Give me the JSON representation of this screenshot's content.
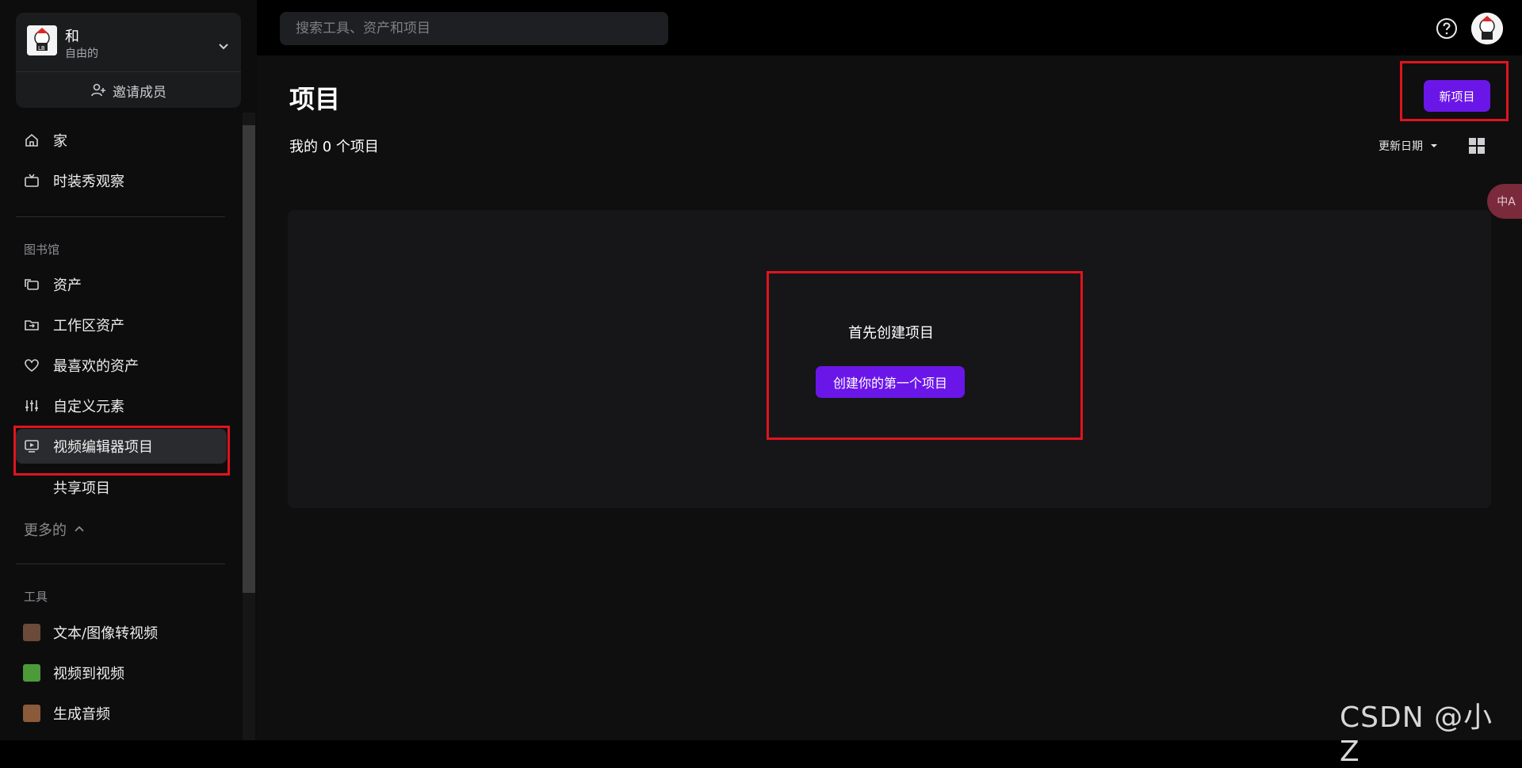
{
  "workspace": {
    "name": "和",
    "plan": "自由的",
    "invite_label": "邀请成员"
  },
  "search": {
    "placeholder": "搜索工具、资产和项目"
  },
  "nav_top": [
    {
      "label": "家",
      "icon": "home-icon"
    },
    {
      "label": "时装秀观察",
      "icon": "tv-icon"
    }
  ],
  "library": {
    "title": "图书馆",
    "items": [
      {
        "label": "资产",
        "icon": "folder-stack-icon"
      },
      {
        "label": "工作区资产",
        "icon": "folder-share-icon"
      },
      {
        "label": "最喜欢的资产",
        "icon": "heart-icon"
      },
      {
        "label": "自定义元素",
        "icon": "sliders-icon"
      },
      {
        "label": "视频编辑器项目",
        "icon": "monitor-play-icon",
        "active": true
      },
      {
        "label": "共享项目"
      }
    ],
    "more_label": "更多的"
  },
  "tools": {
    "title": "工具",
    "items": [
      {
        "label": "文本/图像转视频",
        "icon": "text-to-video-thumbnail",
        "color": "#6b4a3a"
      },
      {
        "label": "视频到视频",
        "icon": "video-to-video-thumbnail",
        "color": "#4c9a3a"
      },
      {
        "label": "生成音频",
        "icon": "audio-thumbnail",
        "color": "#8a5a3a"
      }
    ]
  },
  "main": {
    "title": "项目",
    "count_label": "我的 0 个项目",
    "new_button": "新项目",
    "sort_label": "更新日期",
    "empty_text": "首先创建项目",
    "create_button": "创建你的第一个项目"
  },
  "translate_label": "中A",
  "watermark": "CSDN @小 Z",
  "colors": {
    "accent": "#6b16e8",
    "highlight": "#e0141e",
    "background": "#000000",
    "panel": "#161618"
  }
}
